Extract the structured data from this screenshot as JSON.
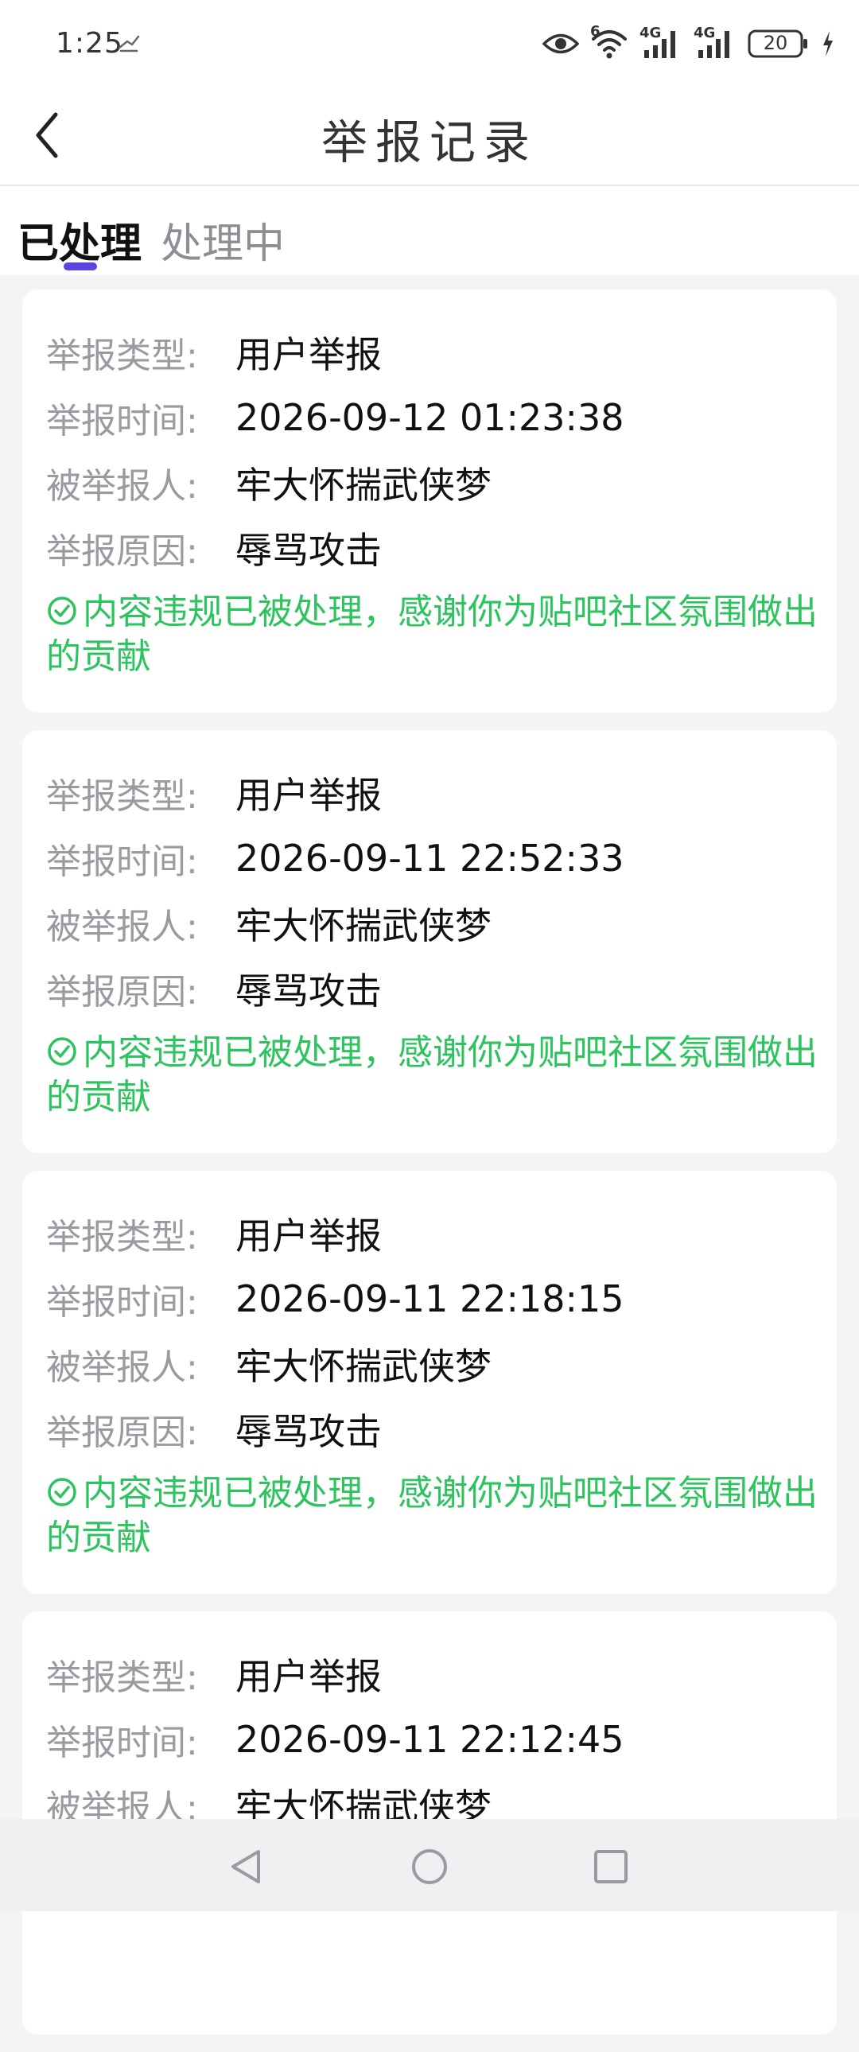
{
  "status_bar": {
    "time": "1:25",
    "network_6": "6",
    "net_4g_1": "4G",
    "net_4g_2": "4G",
    "battery": "20"
  },
  "header": {
    "title": "举报记录"
  },
  "tabs": [
    {
      "label": "已处理"
    },
    {
      "label": "处理中"
    }
  ],
  "labels": {
    "type": "举报类型:",
    "time": "举报时间:",
    "reported": "被举报人:",
    "reason": "举报原因:"
  },
  "records": [
    {
      "type": "用户举报",
      "time": "2026-09-12 01:23:38",
      "reported_user": "牢大怀揣武侠梦",
      "reason": "辱骂攻击",
      "result": "内容违规已被处理，感谢你为贴吧社区氛围做出的贡献"
    },
    {
      "type": "用户举报",
      "time": "2026-09-11 22:52:33",
      "reported_user": "牢大怀揣武侠梦",
      "reason": "辱骂攻击",
      "result": "内容违规已被处理，感谢你为贴吧社区氛围做出的贡献"
    },
    {
      "type": "用户举报",
      "time": "2026-09-11 22:18:15",
      "reported_user": "牢大怀揣武侠梦",
      "reason": "辱骂攻击",
      "result": "内容违规已被处理，感谢你为贴吧社区氛围做出的贡献"
    },
    {
      "type": "用户举报",
      "time": "2026-09-11 22:12:45",
      "reported_user": "牢大怀揣武侠梦"
    }
  ],
  "colors": {
    "accent": "#5a46e0",
    "success": "#2dc35e"
  }
}
